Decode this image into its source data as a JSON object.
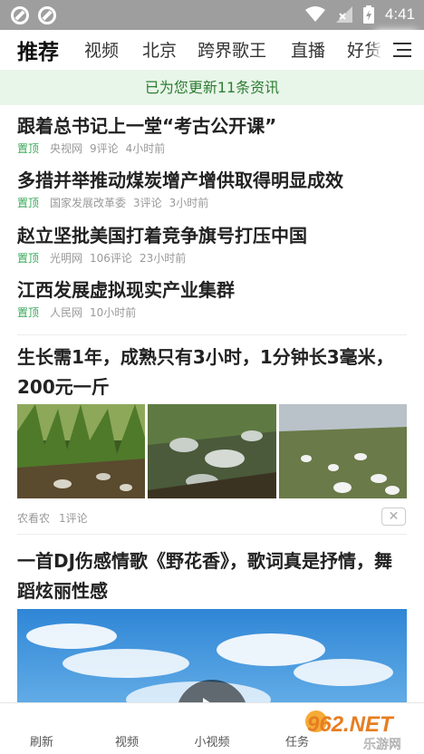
{
  "status_bar": {
    "time": "4:41"
  },
  "tabs": [
    {
      "label": "推荐"
    },
    {
      "label": "视频"
    },
    {
      "label": "北京"
    },
    {
      "label": "跨界歌王"
    },
    {
      "label": "直播"
    },
    {
      "label": "好货"
    }
  ],
  "banner": {
    "text": "已为您更新11条资讯"
  },
  "news": [
    {
      "title": "跟着总书记上一堂“考古公开课”",
      "pin": "置顶",
      "source": "央视网",
      "comments": "9评论",
      "time": "4小时前"
    },
    {
      "title": "多措并举推动煤炭增产增供取得明显成效",
      "pin": "置顶",
      "source": "国家发展改革委",
      "comments": "3评论",
      "time": "3小时前"
    },
    {
      "title": "赵立坚批美国打着竞争旗号打压中国",
      "pin": "置顶",
      "source": "光明网",
      "comments": "106评论",
      "time": "23小时前"
    },
    {
      "title": "江西发展虚拟现实产业集群",
      "pin": "置顶",
      "source": "人民网",
      "comments": "10小时前",
      "time": ""
    }
  ],
  "article1": {
    "title": "生长需1年，成熟只有3小时，1分钟长3毫米，200元一斤",
    "source": "农看农",
    "comments": "1评论",
    "close": "✕"
  },
  "article2": {
    "title": "一首DJ伤感情歌《野花香》，歌词真是抒情，舞蹈炫丽性感"
  },
  "bottom_nav": [
    {
      "label": "刷新"
    },
    {
      "label": "视频"
    },
    {
      "label": "小视频"
    },
    {
      "label": "任务"
    }
  ],
  "watermark": {
    "text": "962.NET",
    "subtext": "乐游网"
  },
  "colors": {
    "accent_green": "#3aa85a",
    "banner_bg": "#e8f5e9",
    "status_bar": "#9e9e9e"
  }
}
